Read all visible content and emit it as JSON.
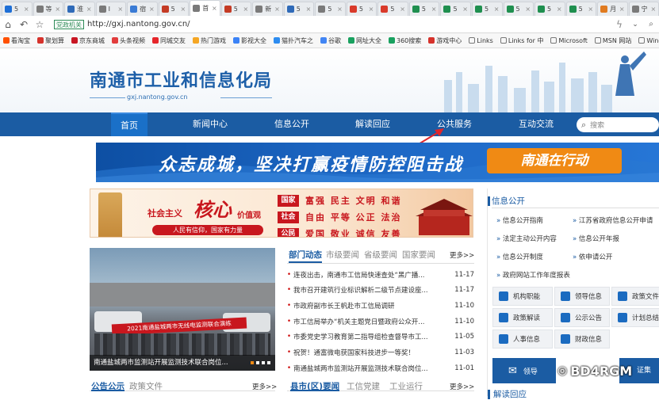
{
  "browser": {
    "tabs": [
      {
        "label": "5",
        "icon_color": "#1e6fd6"
      },
      {
        "label": "等",
        "icon_color": "#7a7a7a"
      },
      {
        "label": "淮",
        "icon_color": "#2f6ab8"
      },
      {
        "label": "Ⅰ",
        "icon_color": "#7a7a7a"
      },
      {
        "label": "宿",
        "icon_color": "#3a7bd5"
      },
      {
        "label": "5",
        "icon_color": "#c43b25"
      },
      {
        "label": "首",
        "icon_color": "#7a7a7a",
        "active": true
      },
      {
        "label": "5",
        "icon_color": "#c43b25"
      },
      {
        "label": "新",
        "icon_color": "#7a7a7a"
      },
      {
        "label": "5",
        "icon_color": "#2f6ab8"
      },
      {
        "label": "5",
        "icon_color": "#7a7a7a"
      },
      {
        "label": "5",
        "icon_color": "#d93a2a"
      },
      {
        "label": "5",
        "icon_color": "#d93a2a"
      },
      {
        "label": "5",
        "icon_color": "#1f8f4f"
      },
      {
        "label": "5",
        "icon_color": "#1f8f4f"
      },
      {
        "label": "5",
        "icon_color": "#1f8f4f"
      },
      {
        "label": "5",
        "icon_color": "#1f8f4f"
      },
      {
        "label": "5",
        "icon_color": "#1f8f4f"
      },
      {
        "label": "5",
        "icon_color": "#1f8f4f"
      },
      {
        "label": "月",
        "icon_color": "#e07b20"
      },
      {
        "label": "宁",
        "icon_color": "#7a7a7a"
      }
    ],
    "gov_badge": "党政机关",
    "url": "http://gxj.nantong.gov.cn/",
    "bookmarks": [
      {
        "label": "看淘宝",
        "color": "#ff5000"
      },
      {
        "label": "聚划算",
        "color": "#d6322b"
      },
      {
        "label": "京东商城",
        "color": "#c81623"
      },
      {
        "label": "头条视频",
        "color": "#e23d3d"
      },
      {
        "label": "同城交友",
        "color": "#e6262b"
      },
      {
        "label": "热门游戏",
        "color": "#f5a623"
      },
      {
        "label": "影视大全",
        "color": "#3b82f6"
      },
      {
        "label": "猫扑汽车之",
        "color": "#2d8cf0"
      },
      {
        "label": "谷歌",
        "color": "#4285f4"
      },
      {
        "label": "网址大全",
        "color": "#19a15f"
      },
      {
        "label": "360搜索",
        "color": "#19a15f"
      },
      {
        "label": "游戏中心",
        "color": "#d6322b"
      },
      {
        "label": "Links",
        "folder": true
      },
      {
        "label": "Links for 中",
        "folder": true
      },
      {
        "label": "Microsoft",
        "folder": true
      },
      {
        "label": "MSN 网站",
        "folder": true
      },
      {
        "label": "Windows",
        "folder": true
      }
    ]
  },
  "site": {
    "title": "南通市工业和信息化局",
    "domain": "gxj.nantong.gov.cn",
    "nav": [
      "首页",
      "新闻中心",
      "信息公开",
      "解读回应",
      "公共服务",
      "互动交流"
    ],
    "search_placeholder": "搜索",
    "banner_slogan": "众志成城，坚决打赢疫情防控阻击战",
    "banner_badge": "南通在行动",
    "values_banner": {
      "left_title": "社会主义",
      "left_core": "核心",
      "left_suffix": "价值观",
      "left_sub": "人民有信仰，国家有力量",
      "rows": [
        {
          "tag": "国家",
          "text": "富强 民主 文明 和谐"
        },
        {
          "tag": "社会",
          "text": "自由 平等 公正 法治"
        },
        {
          "tag": "公民",
          "text": "爱国 敬业 诚信 友善"
        }
      ]
    },
    "photo": {
      "sign": "2021南通盐城两市无线电监测联合演练",
      "caption": "南通盐城两市监测站开展监测技术联合岗位..."
    },
    "news_tabs": [
      "部门动态",
      "市级要闻",
      "省级要闻",
      "国家要闻"
    ],
    "more": "更多>>",
    "news": [
      {
        "title": "连夜出击，南通市工信局快速查处“黑广播...",
        "date": "11-17"
      },
      {
        "title": "我市召开建筑行业标识解析二级节点建设座...",
        "date": "11-17"
      },
      {
        "title": "市政府副市长王帆赴市工信局调研",
        "date": "11-10"
      },
      {
        "title": "市工信局举办“机关主题党日暨政府公众开...",
        "date": "11-10"
      },
      {
        "title": "市委党史学习教育第二指导组检查督导市工...",
        "date": "11-05"
      },
      {
        "title": "祝贺！通富微电获国家科技进步一等奖！",
        "date": "11-03"
      },
      {
        "title": "南通盐城两市监测站开展监测技术联合岗位...",
        "date": "11-01"
      }
    ],
    "bottom_tabs_left": [
      "公告公示",
      "政策文件"
    ],
    "bottom_tabs_mid": [
      "县市(区)要闻",
      "工信党建",
      "工业运行"
    ],
    "info_open": {
      "title": "信息公开",
      "links": [
        [
          "信息公开指南",
          "江苏省政府信息公开申请"
        ],
        [
          "法定主动公开内容",
          "信息公开年报"
        ],
        [
          "信息公开制度",
          "依申请公开"
        ],
        [
          "政府网站工作年度报表",
          ""
        ]
      ],
      "buttons": [
        [
          "机构职能",
          "领导信息",
          "政策文件"
        ],
        [
          "政策解读",
          "公示公告",
          "计划总结"
        ],
        [
          "人事信息",
          "财政信息",
          ""
        ]
      ],
      "lead_label": "领导",
      "cert_label": "证集"
    },
    "bottom_right_title": "解读回应",
    "watermark": "BD4RGM"
  }
}
